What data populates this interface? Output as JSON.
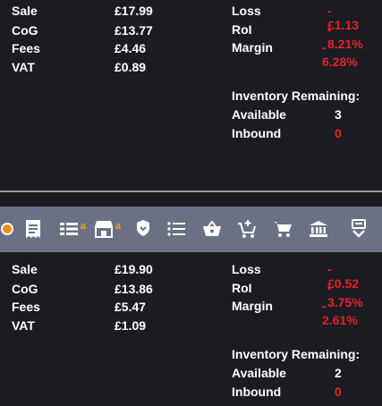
{
  "top": {
    "left": [
      {
        "label": "Sale",
        "value": "£17.99"
      },
      {
        "label": "CoG",
        "value": "£13.77"
      },
      {
        "label": "Fees",
        "value": "£4.46"
      },
      {
        "label": "VAT",
        "value": "£0.89"
      }
    ],
    "right": [
      {
        "label": "Loss",
        "value": "- £1.13"
      },
      {
        "label": "RoI",
        "value": "- 8.21%"
      },
      {
        "label": "Margin",
        "value": "- 6.28%"
      }
    ],
    "inventory_header": "Inventory Remaining:",
    "available_label": "Available",
    "available_value": "3",
    "inbound_label": "Inbound",
    "inbound_value": "0"
  },
  "bottom": {
    "left": [
      {
        "label": "Sale",
        "value": "£19.90"
      },
      {
        "label": "CoG",
        "value": "£13.86"
      },
      {
        "label": "Fees",
        "value": "£5.47"
      },
      {
        "label": "VAT",
        "value": "£1.09"
      }
    ],
    "right": [
      {
        "label": "Loss",
        "value": "- £0.52"
      },
      {
        "label": "RoI",
        "value": "- 3.75%"
      },
      {
        "label": "Margin",
        "value": "- 2.61%"
      }
    ],
    "inventory_header": "Inventory Remaining:",
    "available_label": "Available",
    "available_value": "2",
    "inbound_label": "Inbound",
    "inbound_value": "0"
  },
  "toolbar": {
    "badge_letter": "a",
    "icons": [
      "orange-circle-icon",
      "receipt-icon",
      "amazon-list-icon",
      "amazon-store-icon",
      "shield-down-icon",
      "list-icon",
      "basket-icon",
      "add-to-cart-icon",
      "cart-icon",
      "bank-icon",
      "download-box-icon"
    ]
  },
  "colors": {
    "background": "#1c1b22",
    "toolbar": "#6a7184",
    "negative": "#e3242b",
    "badge": "#f0a800"
  }
}
